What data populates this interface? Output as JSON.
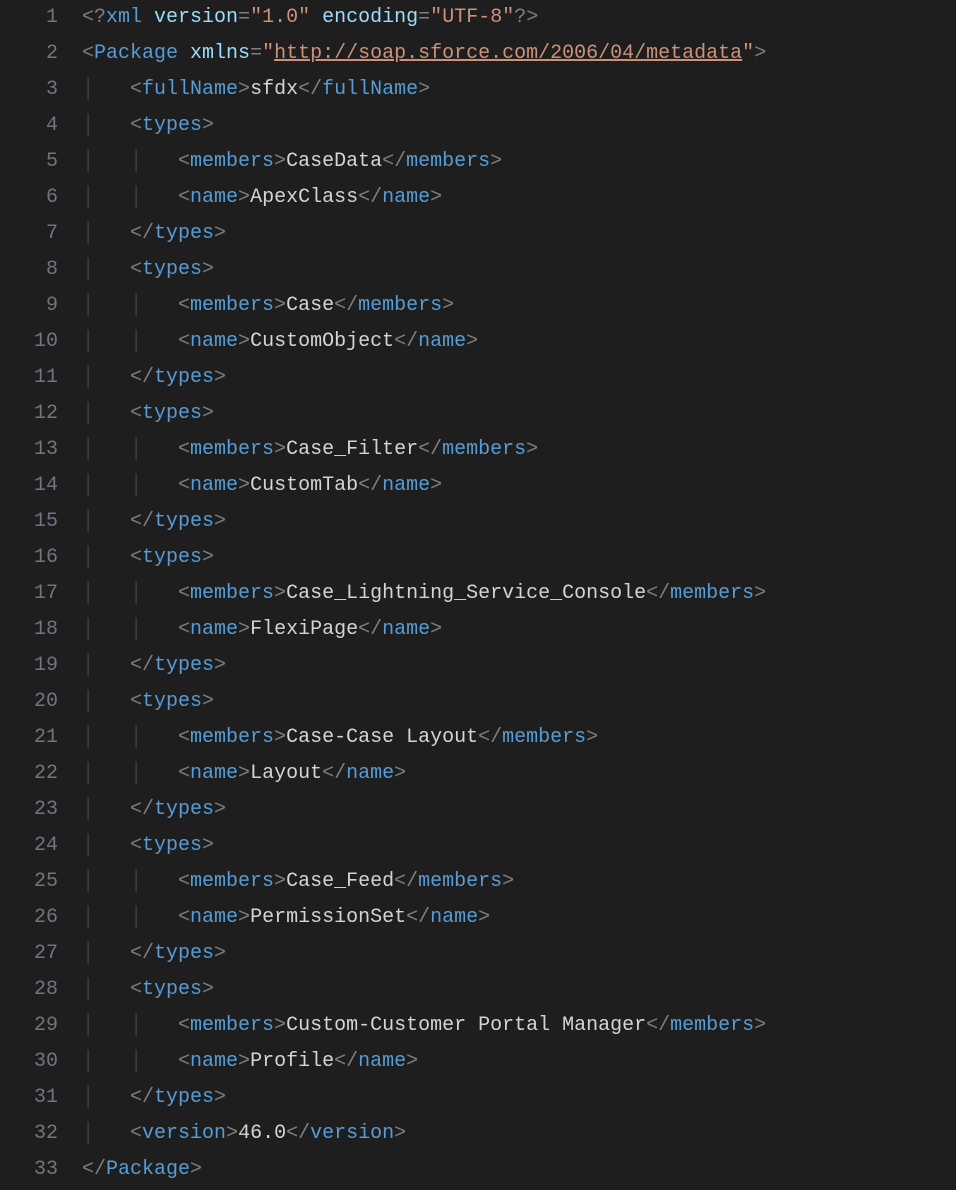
{
  "file": {
    "xml_declaration": {
      "version": "1.0",
      "encoding": "UTF-8"
    },
    "package": {
      "xmlns": "http://soap.sforce.com/2006/04/metadata",
      "fullName": "sfdx",
      "types": [
        {
          "members": "CaseData",
          "name": "ApexClass"
        },
        {
          "members": "Case",
          "name": "CustomObject"
        },
        {
          "members": "Case_Filter",
          "name": "CustomTab"
        },
        {
          "members": "Case_Lightning_Service_Console",
          "name": "FlexiPage"
        },
        {
          "members": "Case-Case Layout",
          "name": "Layout"
        },
        {
          "members": "Case_Feed",
          "name": "PermissionSet"
        },
        {
          "members": "Custom-Customer Portal Manager",
          "name": "Profile"
        }
      ],
      "version": "46.0"
    }
  },
  "tokens": {
    "xml": "xml",
    "version_attr": "version",
    "encoding_attr": "encoding",
    "package_tag": "Package",
    "xmlns_attr": "xmlns",
    "fullName_tag": "fullName",
    "types_tag": "types",
    "members_tag": "members",
    "name_tag": "name",
    "version_tag": "version"
  },
  "line_numbers": [
    "1",
    "2",
    "3",
    "4",
    "5",
    "6",
    "7",
    "8",
    "9",
    "10",
    "11",
    "12",
    "13",
    "14",
    "15",
    "16",
    "17",
    "18",
    "19",
    "20",
    "21",
    "22",
    "23",
    "24",
    "25",
    "26",
    "27",
    "28",
    "29",
    "30",
    "31",
    "32",
    "33"
  ]
}
